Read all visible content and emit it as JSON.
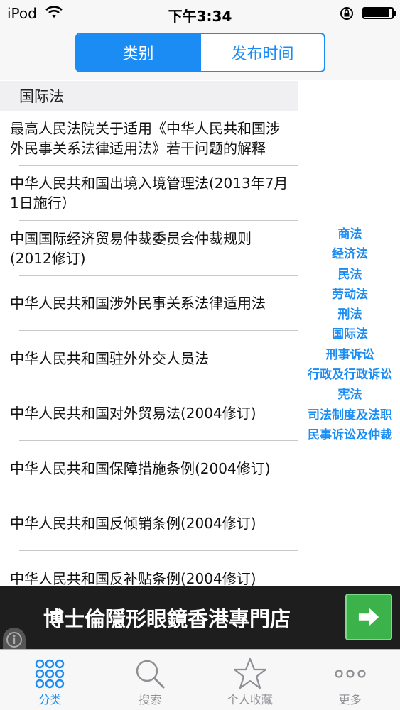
{
  "status_bar": {
    "carrier": "iPod",
    "time": "下午3:34",
    "battery_level": 0.9
  },
  "nav": {
    "segments": [
      "类别",
      "发布时间"
    ],
    "selected_segment": 0
  },
  "list": {
    "section_title": "国际法",
    "items": [
      "最高人民法院关于适用《中华人民共和国涉外民事关系法律适用法》若干问题的解释",
      "中华人民共和国出境入境管理法(2013年7月1日施行）",
      "中国国际经济贸易仲裁委员会仲裁规则(2012修订)",
      "中华人民共和国涉外民事关系法律适用法",
      "中华人民共和国驻外外交人员法",
      "中华人民共和国对外贸易法(2004修订)",
      "中华人民共和国保障措施条例(2004修订)",
      "中华人民共和国反倾销条例(2004修订)",
      "中华人民共和国反补贴条例(2004修订)"
    ]
  },
  "index": [
    "商法",
    "经济法",
    "民法",
    "劳动法",
    "刑法",
    "国际法",
    "刑事诉讼",
    "行政及行政诉讼",
    "宪法",
    "司法制度及法职",
    "民事诉讼及仲裁"
  ],
  "ad": {
    "text": "博士倫隱形眼鏡香港專門店"
  },
  "tabs": [
    {
      "label": "分类",
      "icon": "grid-icon",
      "active": true
    },
    {
      "label": "搜索",
      "icon": "search-icon",
      "active": false
    },
    {
      "label": "个人收藏",
      "icon": "star-icon",
      "active": false
    },
    {
      "label": "更多",
      "icon": "more-icon",
      "active": false
    }
  ],
  "colors": {
    "accent": "#1a8cf4",
    "ad_button": "#3bb34a",
    "tab_inactive": "#8e8e93"
  }
}
